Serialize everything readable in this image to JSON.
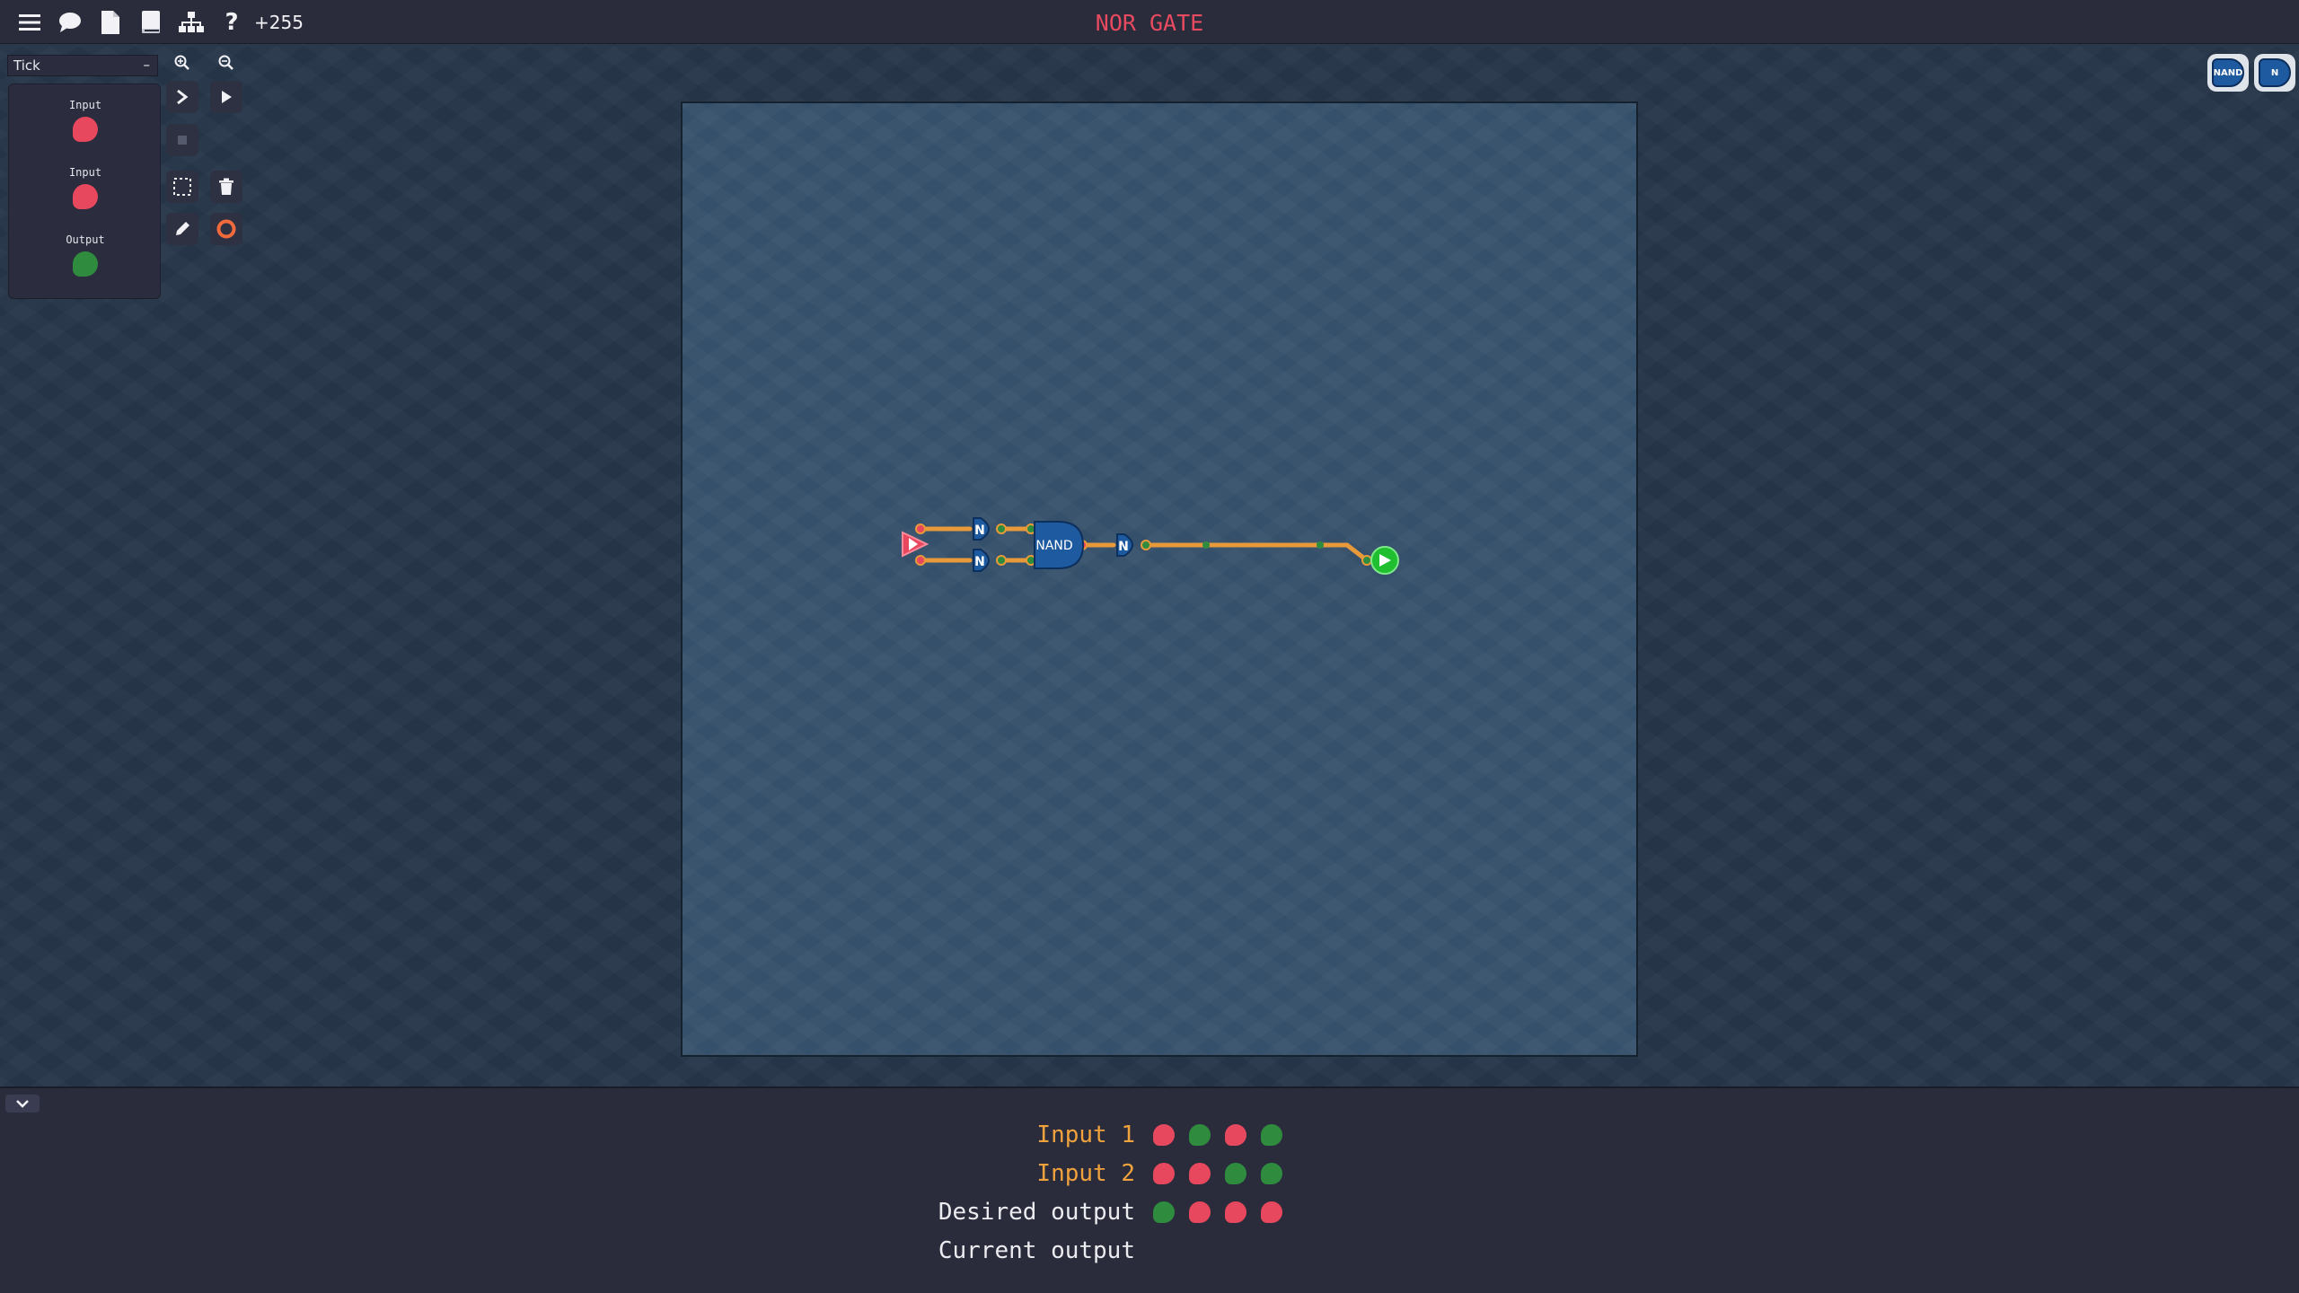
{
  "topbar": {
    "score": "+255",
    "level_title": "NOR GATE",
    "icons": [
      "menu-icon",
      "chat-icon",
      "file-icon",
      "book-icon",
      "hierarchy-icon",
      "help-icon"
    ]
  },
  "toolbar": {
    "speed_label": "Tick",
    "speed_minus": "–"
  },
  "io_panel": {
    "items": [
      {
        "label": "Input",
        "state": "off"
      },
      {
        "label": "Input",
        "state": "off"
      },
      {
        "label": "Output",
        "state": "on"
      }
    ]
  },
  "board": {
    "gates": [
      {
        "kind": "NOT",
        "label": "N"
      },
      {
        "kind": "NOT",
        "label": "N"
      },
      {
        "kind": "NAND",
        "label": "NAND"
      },
      {
        "kind": "NOT",
        "label": "N"
      }
    ]
  },
  "corner_gates": [
    {
      "label": "NAND"
    },
    {
      "label": "N"
    }
  ],
  "truth_table": {
    "rows": [
      {
        "label": "Input 1",
        "color": "#f0a23c",
        "values": [
          0,
          1,
          0,
          1
        ]
      },
      {
        "label": "Input 2",
        "color": "#f0a23c",
        "values": [
          0,
          0,
          1,
          1
        ]
      },
      {
        "label": "Desired output",
        "color": "#ececf0",
        "values": [
          1,
          0,
          0,
          0
        ]
      },
      {
        "label": "Current output",
        "color": "#ececf0",
        "values": []
      }
    ]
  },
  "colors": {
    "off": "#e8485e",
    "on": "#2f8c3e",
    "wire": "#e89a3a",
    "gate": "#1e5aa0",
    "title": "#e84a5f"
  }
}
